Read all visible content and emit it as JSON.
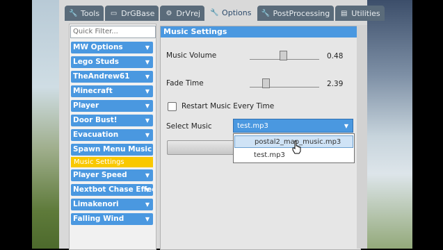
{
  "tabs": [
    {
      "label": "Tools",
      "icon": "wrench-icon"
    },
    {
      "label": "DrGBase",
      "icon": "device-icon"
    },
    {
      "label": "DrVrej",
      "icon": "gear-icon"
    },
    {
      "label": "Options",
      "icon": "wrench-icon"
    },
    {
      "label": "PostProcessing",
      "icon": "wrench-icon"
    },
    {
      "label": "Utilities",
      "icon": "tag-icon"
    }
  ],
  "active_tab": "Options",
  "sidebar": {
    "filter_placeholder": "Quick Filter...",
    "categories": [
      "MW Options",
      "Lego Studs",
      "TheAndrew61",
      "Minecraft",
      "Player",
      "Door Bust!",
      "Evacuation",
      "Spawn Menu Music",
      "Player Speed",
      "Nextbot Chase Effect",
      "Limakenori",
      "Falling Wind"
    ],
    "selected_subitem": "Music Settings"
  },
  "panel": {
    "title": "Music Settings",
    "music_volume_label": "Music Volume",
    "music_volume_value": "0.48",
    "fade_time_label": "Fade Time",
    "fade_time_value": "2.39",
    "restart_label": "Restart Music Every Time",
    "restart_checked": false,
    "select_label": "Select Music",
    "select_value": "test.mp3",
    "dropdown_options": [
      "postal2_map_music.mp3",
      "test.mp3"
    ],
    "highlighted_option": "postal2_map_music.mp3"
  },
  "colors": {
    "accent_blue": "#4a98e0",
    "selected_yellow": "#f9c800"
  }
}
